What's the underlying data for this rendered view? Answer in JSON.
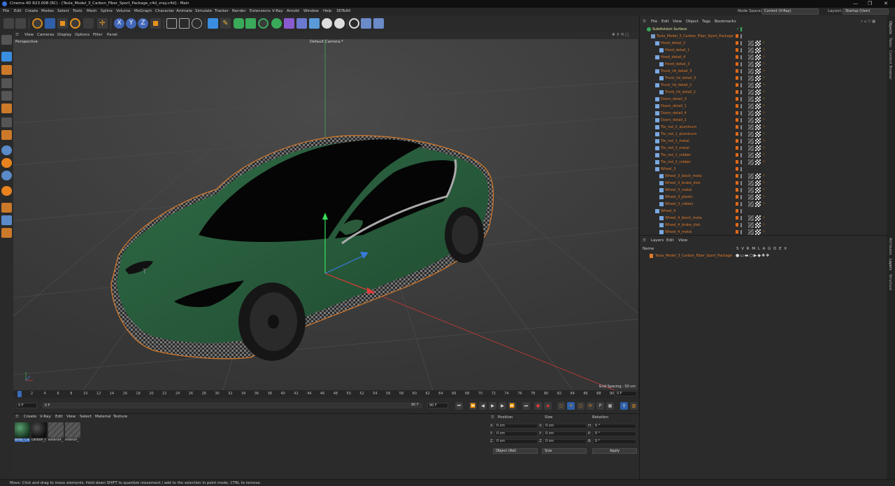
{
  "window": {
    "title": "Cinema 4D R23.008 (RC) - [Tesla_Model_3_Carbon_Fiber_Sport_Package_c4d_vray.c4d] - Main",
    "controls": [
      "—",
      "❐",
      "✕"
    ]
  },
  "menubar": {
    "items": [
      "File",
      "Edit",
      "Create",
      "Modes",
      "Select",
      "Tools",
      "Mesh",
      "Spline",
      "Volume",
      "MoGraph",
      "Character",
      "Animate",
      "Simulate",
      "Tracker",
      "Render",
      "Extensions",
      "V-Ray",
      "Arnold",
      "Window",
      "Help",
      "3DToAll"
    ],
    "node_space_label": "Node Space:",
    "node_space_value": "Current (V-Ray)",
    "layout_label": "Layout:",
    "layout_value": "Startup (User)"
  },
  "toolbar": {
    "icons": [
      "undo-icon",
      "redo-icon",
      "live-select-icon",
      "move-icon",
      "scale-icon",
      "rotate-icon",
      "recent-tool-icon",
      "x-axis-icon",
      "y-axis-icon",
      "z-axis-icon",
      "coordinate-system-icon",
      "render-view-icon",
      "render-picture-viewer-icon",
      "edit-render-settings-icon",
      "cube-icon",
      "pen-icon",
      "subdivision-icon",
      "extrude-icon",
      "cloner-icon",
      "field-icon",
      "deformer-icon",
      "floor-icon",
      "camera-icon",
      "light-icon",
      "vray-icon",
      "vray-render-icon",
      "3dtoall-icon"
    ]
  },
  "viewport": {
    "menu": [
      "View",
      "Cameras",
      "Display",
      "Options",
      "Filter",
      "Panel"
    ],
    "label": "Perspective",
    "camera": "Default Camera:*",
    "grid_spacing": "Grid Spacing : 50 cm"
  },
  "timeline": {
    "ticks": [
      "0",
      "2",
      "4",
      "6",
      "8",
      "10",
      "12",
      "14",
      "16",
      "18",
      "20",
      "22",
      "24",
      "26",
      "28",
      "30",
      "32",
      "34",
      "36",
      "38",
      "40",
      "42",
      "44",
      "46",
      "48",
      "50",
      "52",
      "54",
      "56",
      "58",
      "60",
      "62",
      "64",
      "66",
      "68",
      "70",
      "72",
      "74",
      "76",
      "78",
      "80",
      "82",
      "84",
      "86",
      "88",
      "90"
    ],
    "end_frame": "0 F",
    "current_frame": "0 F",
    "range_start": "0 F",
    "range_end": "90 F",
    "max_frame": "90 F"
  },
  "material_manager": {
    "menu": [
      "Create",
      "V-Ray",
      "Edit",
      "View",
      "Select",
      "Material",
      "Texture"
    ],
    "materials": [
      {
        "label": "body_Ca",
        "color": "#2a5a3a"
      },
      {
        "label": "carbon_t",
        "color": "#202020"
      },
      {
        "label": "exterior_",
        "color": "#555555"
      },
      {
        "label": "interior_",
        "color": "#5a5a5a"
      }
    ]
  },
  "coordinates": {
    "headers": [
      "Position",
      "Size",
      "Rotation"
    ],
    "rows": [
      {
        "axis": "X",
        "pos": "0 cm",
        "size_axis": "X",
        "size": "0 cm",
        "rot_axis": "H",
        "rot": "0 °"
      },
      {
        "axis": "Y",
        "pos": "0 cm",
        "size_axis": "Y",
        "size": "0 cm",
        "rot_axis": "P",
        "rot": "0 °"
      },
      {
        "axis": "Z",
        "pos": "0 cm",
        "size_axis": "Z",
        "size": "0 cm",
        "rot_axis": "B",
        "rot": "0 °"
      }
    ],
    "mode": "Object (Rel)",
    "size_mode": "Size",
    "apply": "Apply"
  },
  "object_manager": {
    "menu": [
      "File",
      "Edit",
      "View",
      "Object",
      "Tags",
      "Bookmarks"
    ],
    "objects": [
      {
        "name": "Subdivision Surface",
        "level": 0,
        "color": "#e8e8a0"
      },
      {
        "name": "Tesla_Model_3_Carbon_Fiber_Sport_Package",
        "level": 1,
        "color": "#e07a2a"
      },
      {
        "name": "Hood_detail_2",
        "level": 2,
        "color": "#e07a2a"
      },
      {
        "name": "Hood_detail_1",
        "level": 3,
        "color": "#e07a2a"
      },
      {
        "name": "Hood_detail_4",
        "level": 2,
        "color": "#e07a2a"
      },
      {
        "name": "Hood_detail_3",
        "level": 3,
        "color": "#e07a2a"
      },
      {
        "name": "Trunk_lid_detail_3",
        "level": 2,
        "color": "#e07a2a"
      },
      {
        "name": "Trunk_lid_detail_3",
        "level": 3,
        "color": "#e07a2a"
      },
      {
        "name": "Trunk_lid_detail_2",
        "level": 2,
        "color": "#e07a2a"
      },
      {
        "name": "Trunk_lid_detail_1",
        "level": 3,
        "color": "#e07a2a"
      },
      {
        "name": "Doors_detail_3",
        "level": 2,
        "color": "#e07a2a"
      },
      {
        "name": "Doors_detail_1",
        "level": 2,
        "color": "#e07a2a"
      },
      {
        "name": "Doors_detail_4",
        "level": 2,
        "color": "#e07a2a"
      },
      {
        "name": "Doors_detail_2",
        "level": 2,
        "color": "#e07a2a"
      },
      {
        "name": "Tie_rod_2_aluminum",
        "level": 2,
        "color": "#e07a2a"
      },
      {
        "name": "Tie_rod_1_aluminum",
        "level": 2,
        "color": "#e07a2a"
      },
      {
        "name": "Tie_rod_1_metal",
        "level": 2,
        "color": "#e07a2a"
      },
      {
        "name": "Tie_rod_2_metal",
        "level": 2,
        "color": "#e07a2a"
      },
      {
        "name": "Tie_rod_1_rubber",
        "level": 2,
        "color": "#e07a2a"
      },
      {
        "name": "Tie_rod_2_rubber",
        "level": 2,
        "color": "#e07a2a"
      },
      {
        "name": "Wheel_3",
        "level": 2,
        "color": "#e07a2a"
      },
      {
        "name": "Wheel_3_black_meta",
        "level": 3,
        "color": "#e07a2a"
      },
      {
        "name": "Wheel_3_brake_disk",
        "level": 3,
        "color": "#e07a2a"
      },
      {
        "name": "Wheel_3_metal",
        "level": 3,
        "color": "#e07a2a"
      },
      {
        "name": "Wheel_3_plastic",
        "level": 3,
        "color": "#e07a2a"
      },
      {
        "name": "Wheel_3_rubber",
        "level": 3,
        "color": "#e07a2a"
      },
      {
        "name": "Wheel_4",
        "level": 2,
        "color": "#e07a2a"
      },
      {
        "name": "Wheel_4_black_meta",
        "level": 3,
        "color": "#e07a2a"
      },
      {
        "name": "Wheel_4_brake_disk",
        "level": 3,
        "color": "#e07a2a"
      },
      {
        "name": "Wheel_4_metal",
        "level": 3,
        "color": "#e07a2a"
      }
    ]
  },
  "layers": {
    "menu": [
      "Layers",
      "Edit",
      "View"
    ],
    "col_name": "Name",
    "col_flags": "S V R M L A G D E X",
    "rows": [
      {
        "name": "Tesla_Model_3_Carbon_Fiber_Sport_Package"
      }
    ]
  },
  "right_tabs": [
    "Objects",
    "Takes",
    "Content Browser",
    "Attributes",
    "Layers",
    "Structure"
  ],
  "status": "Move: Click and drag to move elements. Hold down SHIFT to quantize movement / add to the selection in point mode, CTRL to remove."
}
